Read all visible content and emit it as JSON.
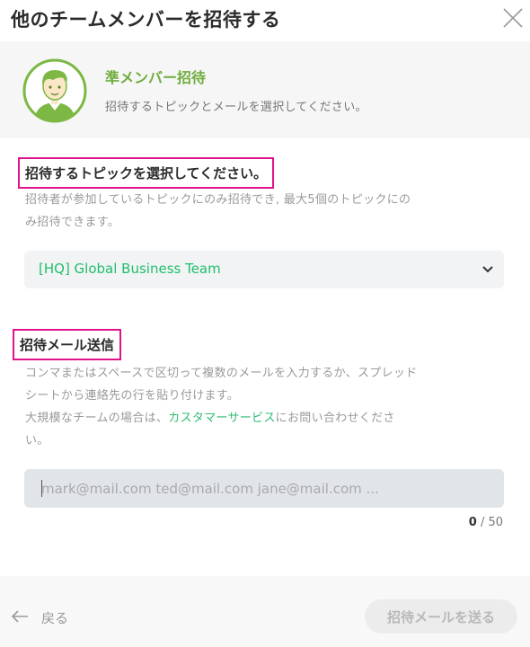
{
  "dialog": {
    "title": "他のチームメンバーを招待する"
  },
  "banner": {
    "title": "準メンバー招待",
    "subtitle": "招待するトピックとメールを選択してください。"
  },
  "topic_section": {
    "title": "招待するトピックを選択してください。",
    "desc_line1": "招待者が参加しているトピックにのみ招待でき, 最大5個のトピックにの",
    "desc_line2": "み招待できます。",
    "selected_topic": "[HQ] Global Business Team"
  },
  "email_section": {
    "title": "招待メール送信",
    "desc_line1": "コンマまたはスペースで区切って複数のメールを入力するか、スプレッド",
    "desc_line2": "シートから連絡先の行を貼り付けます。",
    "desc_line3_before": "大規模なチームの場合は、",
    "desc_link": "カスタマーサービス",
    "desc_line3_after": "にお問い合わせくださ",
    "desc_line4": "い。",
    "input_value": "",
    "input_placeholder": "mark@mail.com ted@mail.com jane@mail.com ...",
    "count": "0",
    "max": "/ 50"
  },
  "footer": {
    "back_label": "戻る",
    "send_label": "招待メールを送る"
  },
  "colors": {
    "accent_green": "#6fad3c",
    "link_green": "#2fbc73",
    "highlight_pink": "#e0128c"
  },
  "icons": {
    "close": "close-icon",
    "avatar": "avatar-illustration",
    "dropdown": "chevron-down-icon",
    "back": "arrow-left-icon"
  }
}
